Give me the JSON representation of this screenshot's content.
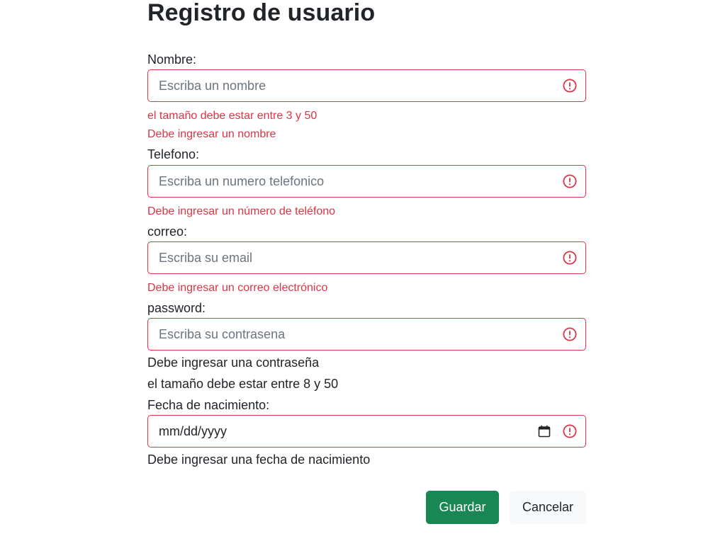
{
  "page": {
    "title": "Registro de usuario"
  },
  "colors": {
    "invalid": "#dc3545",
    "save_button": "#198754",
    "cancel_button": "#f8f9fa",
    "text": "#212529",
    "placeholder": "#6c757d"
  },
  "form": {
    "nombre": {
      "label": "Nombre:",
      "placeholder": "Escriba un nombre",
      "errors": [
        "el tamaño debe estar entre 3 y 50",
        "Debe ingresar un nombre"
      ]
    },
    "telefono": {
      "label": "Telefono:",
      "placeholder": "Escriba un numero telefonico",
      "errors": [
        "Debe ingresar un número de teléfono"
      ]
    },
    "correo": {
      "label": "correo:",
      "placeholder": "Escriba su email",
      "errors": [
        "Debe ingresar un correo electrónico"
      ]
    },
    "password": {
      "label": "password:",
      "placeholder": "Escriba su contrasena",
      "messages": [
        "Debe ingresar una contraseña",
        "el tamaño debe estar entre 8 y 50"
      ]
    },
    "fecha": {
      "label": "Fecha de nacimiento:",
      "placeholder": "mm/dd/yyyy",
      "messages": [
        "Debe ingresar una fecha de nacimiento"
      ]
    }
  },
  "icons": {
    "invalid": "exclamation-circle-icon",
    "calendar": "calendar-icon"
  },
  "buttons": {
    "save_label": "Guardar",
    "cancel_label": "Cancelar"
  }
}
